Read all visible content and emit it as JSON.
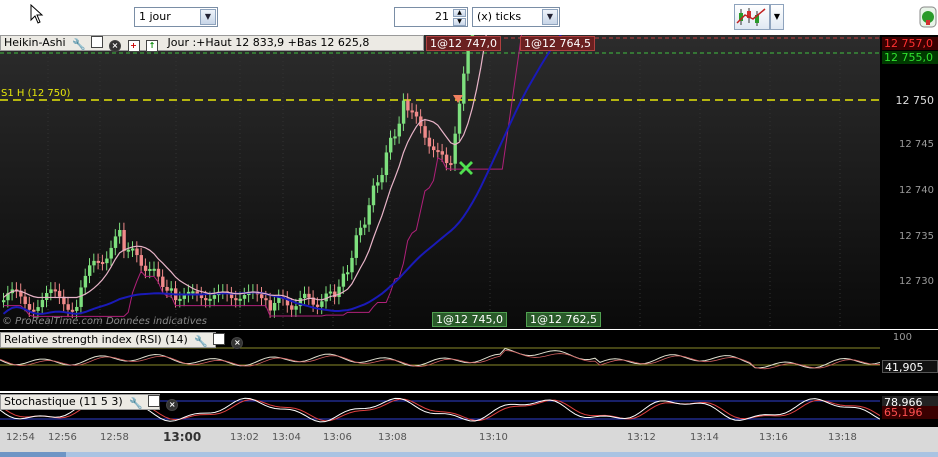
{
  "toolbar": {
    "period_value": "1 jour",
    "ticks_count": "21",
    "ticks_unit": "(x) ticks"
  },
  "price_panel": {
    "header": {
      "title": "Heikin-Ashi",
      "info": "Jour :+Haut 12 833,9 +Bas 12 625,8"
    },
    "s1_label": "S1 H (12 750)",
    "watermark": "© ProRealTime.com  Données indicatives",
    "order_tags_top": [
      "1@12 747,0",
      "1@12 764,5"
    ],
    "order_tags_bottom": [
      "1@12 745,0",
      "1@12 762,5"
    ],
    "price_axis": [
      "12 750",
      "12 745",
      "12 740",
      "12 735",
      "12 730"
    ],
    "current_prices": [
      "12 757,0",
      "12 755,0"
    ]
  },
  "rsi_panel": {
    "title": "Relative strength index (RSI) (14)",
    "axis_top": "100",
    "value": "41,905"
  },
  "stoch_panel": {
    "title": "Stochastique (11 5 3)",
    "values": [
      "78,966",
      "65,196"
    ]
  },
  "time_axis": [
    "12:54",
    "12:56",
    "12:58",
    "13:00",
    "13:02",
    "13:04",
    "13:06",
    "13:08",
    "13:10",
    "13:12",
    "13:14",
    "13:16",
    "13:18"
  ],
  "colors": {
    "up_candle": "#7ee07e",
    "down_candle": "#f08a8a",
    "blue_ma": "#1a1ab8",
    "pink_ma": "#e8b4c8",
    "magenta_line": "#b0207a",
    "s1_line": "#e6e60a",
    "green_tag": "#2e6b2e",
    "red_tag": "#8a2a2a"
  }
}
